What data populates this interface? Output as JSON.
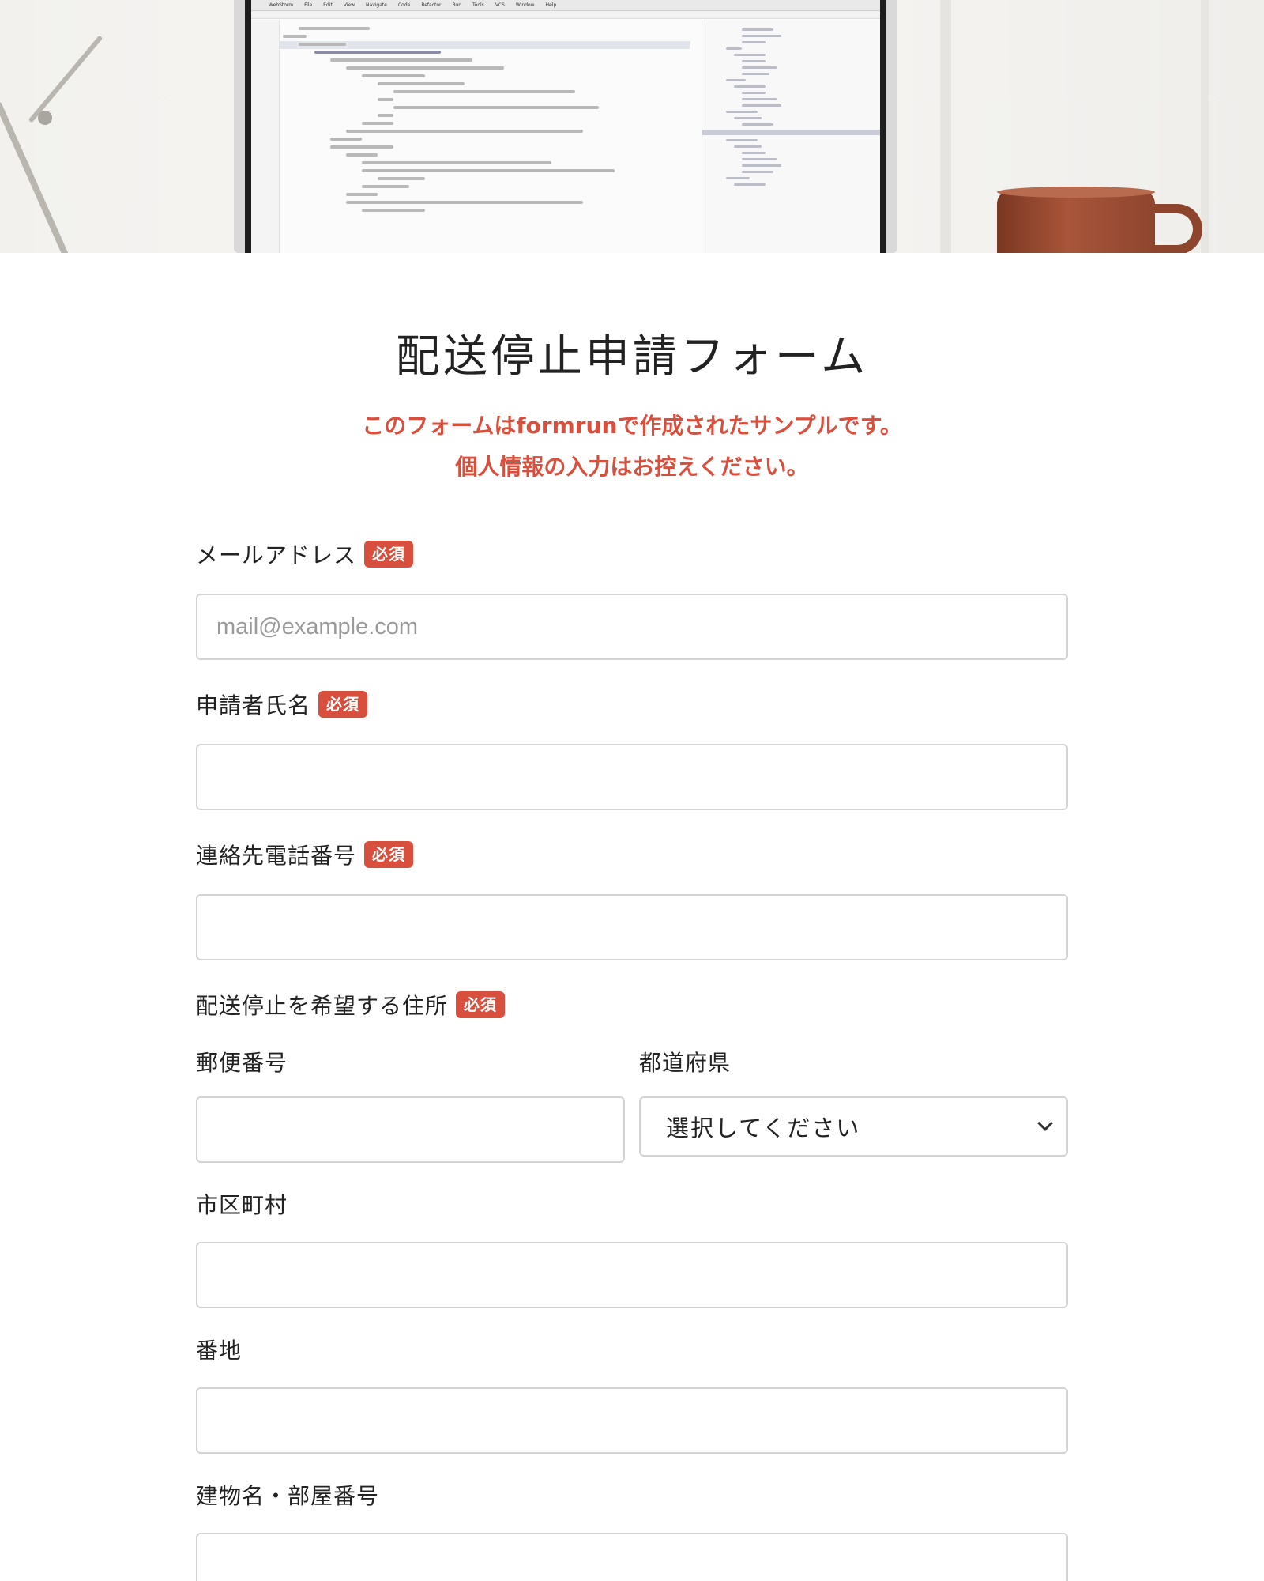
{
  "hero": {
    "menu_items": [
      "WebStorm",
      "File",
      "Edit",
      "View",
      "Navigate",
      "Code",
      "Refactor",
      "Run",
      "Tools",
      "VCS",
      "Window",
      "Help"
    ]
  },
  "form": {
    "title": "配送停止申請フォーム",
    "notice_line1": "このフォームはformrunで作成されたサンプルです。",
    "notice_line2": "個人情報の入力はお控えください。",
    "required_label": "必須",
    "fields": {
      "email": {
        "label": "メールアドレス",
        "placeholder": "mail@example.com",
        "value": ""
      },
      "name": {
        "label": "申請者氏名",
        "value": ""
      },
      "phone": {
        "label": "連絡先電話番号",
        "value": ""
      },
      "address_section": {
        "label": "配送停止を希望する住所"
      },
      "postal_code": {
        "label": "郵便番号",
        "value": ""
      },
      "prefecture": {
        "label": "都道府県",
        "selected": "選択してください"
      },
      "city": {
        "label": "市区町村",
        "value": ""
      },
      "street": {
        "label": "番地",
        "value": ""
      },
      "building": {
        "label": "建物名・部屋番号",
        "value": ""
      }
    }
  },
  "colors": {
    "accent_red": "#d94f3d",
    "input_border": "#d3d3d3",
    "text": "#222222",
    "placeholder": "#9a9a9a"
  }
}
